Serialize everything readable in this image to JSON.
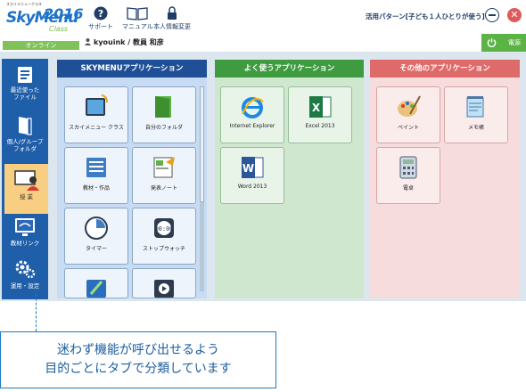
{
  "logo": {
    "tiny": "スカイメニュークラス",
    "sky": "SkyMenu",
    "year": "2016",
    "class": "Class"
  },
  "status": "オンライン",
  "nav": {
    "support": "サポート",
    "manual": "マニュアル",
    "profile": "本人情報変更"
  },
  "user": "kyouink / 教員 和彦",
  "pattern": "活用パターン[子ども１人ひとりが使う]",
  "power": "電源",
  "close": "✕",
  "sidebar": {
    "recent": "最近使った\nファイル",
    "group": "個人/グループ\nフォルダ",
    "class": "授 業",
    "links": "教材リンク",
    "settings": "運用・設定"
  },
  "panels": {
    "skymenu": {
      "title": "SKYMENUアプリケーション",
      "tiles": [
        "スカイメニュー クラス",
        "自分のフォルダ",
        "教材・作品",
        "発表ノート",
        "タイマー",
        "ストップウォッチ"
      ]
    },
    "favorites": {
      "title": "よく使うアプリケーション",
      "tiles": [
        "Internet Explorer",
        "Excel 2013",
        "Word 2013"
      ]
    },
    "others": {
      "title": "その他のアプリケーション",
      "tiles": [
        "ペイント",
        "メモ帳",
        "電卓"
      ]
    }
  },
  "callout": {
    "line1": "迷わず機能が呼び出せるよう",
    "line2": "目的ごとにタブで分類しています"
  },
  "colors": {
    "header_blue": "#1f4f96",
    "favorites_green": "#3e9b3f",
    "others_red": "#df6a6a",
    "sidebar_blue": "#1f5ea8"
  }
}
